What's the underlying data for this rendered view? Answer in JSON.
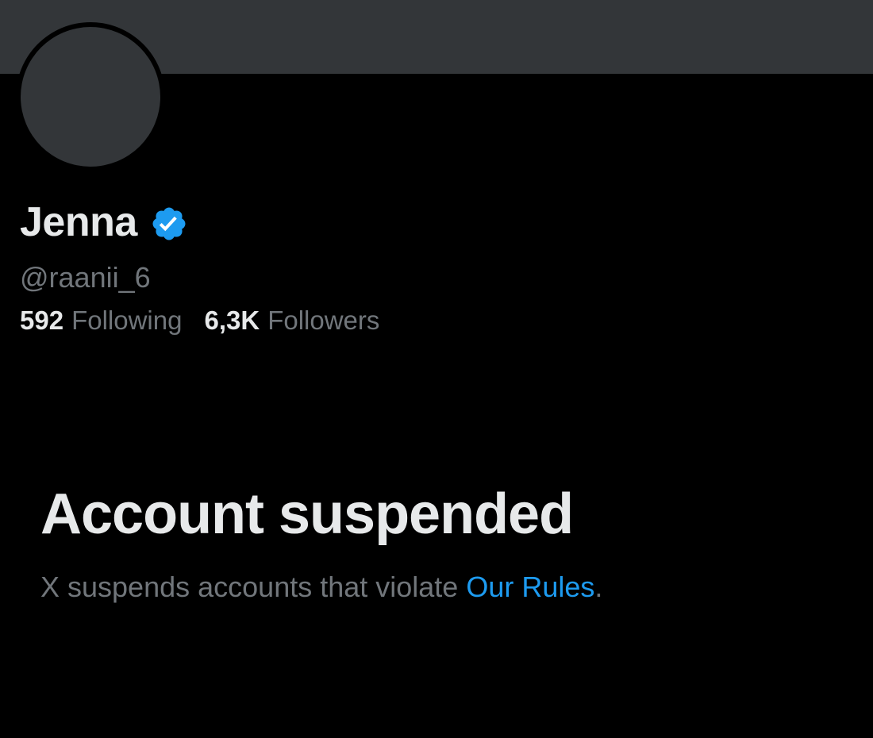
{
  "profile": {
    "display_name": "Jenna",
    "verified_icon": "verified-badge-icon",
    "handle": "@raanii_6",
    "following_count": "592",
    "following_label": "Following",
    "followers_count": "6,3K",
    "followers_label": "Followers"
  },
  "suspension": {
    "title": "Account suspended",
    "message": "X suspends accounts that violate ",
    "link_label": "Our Rules",
    "trailing": "."
  },
  "colors": {
    "background": "#000000",
    "banner": "#333639",
    "avatar": "#333639",
    "primary_text": "#e7e9ea",
    "secondary_text": "#71767b",
    "link": "#1d9bf0",
    "verified_badge": "#1d9bf0"
  }
}
